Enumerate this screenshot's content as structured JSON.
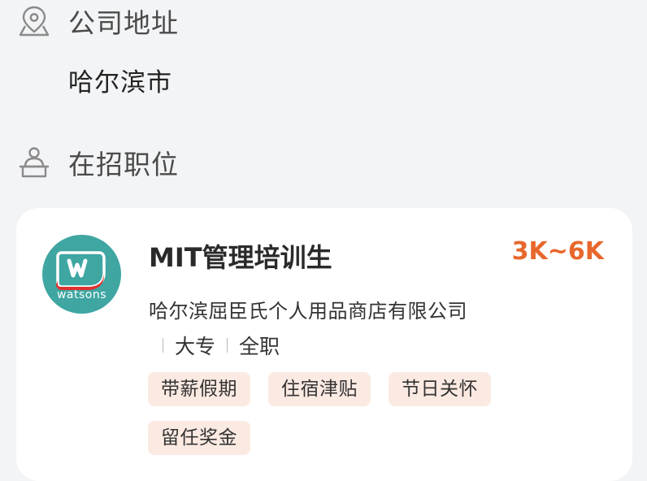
{
  "address_section": {
    "icon": "map-pin-icon",
    "title": "公司地址",
    "value": "哈尔滨市"
  },
  "positions_section": {
    "icon": "person-desk-icon",
    "title": "在招职位"
  },
  "job": {
    "logo_text": "watsons",
    "title": "MIT管理培训生",
    "salary": "3K~6K",
    "company": "哈尔滨屈臣氏个人用品商店有限公司",
    "requirements": [
      "大专",
      "全职"
    ],
    "tags": [
      "带薪假期",
      "住宿津贴",
      "节日关怀",
      "留任奖金"
    ]
  },
  "colors": {
    "accent": "#e8672c",
    "logo_bg": "#3fa6a2",
    "tag_bg": "#fbeae2",
    "page_bg": "#f3f4f6"
  }
}
